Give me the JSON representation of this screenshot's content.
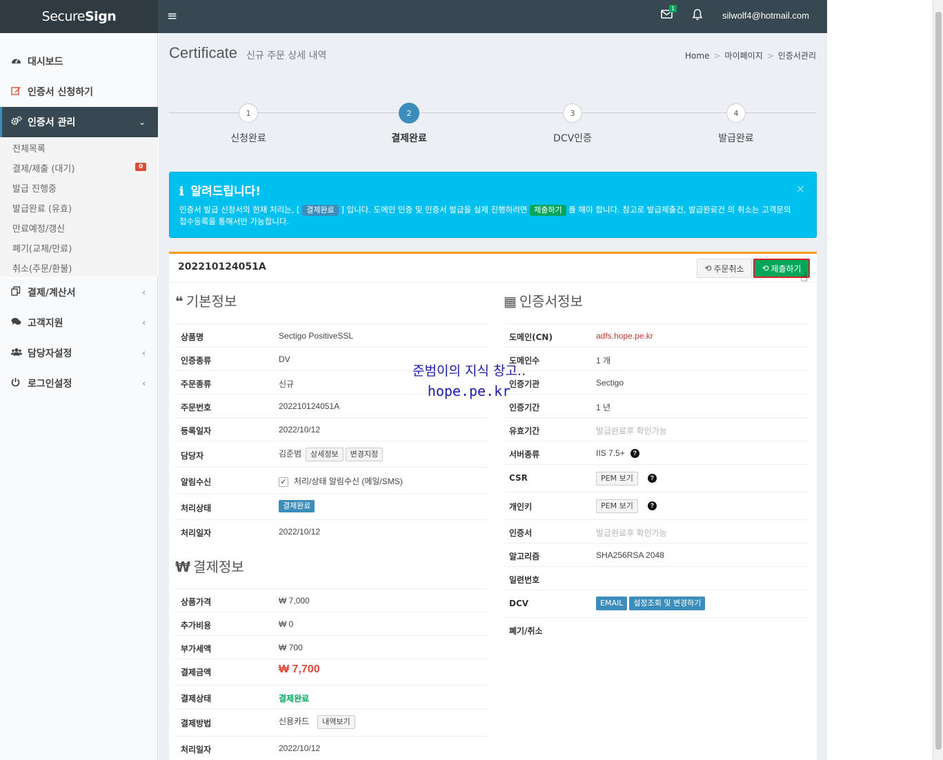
{
  "brand": {
    "logo_light": "Secure",
    "logo_bold": "Sign"
  },
  "topbar": {
    "menu_icon": "≡",
    "mail_count": "1",
    "user_email": "silwolf4@hotmail.com"
  },
  "sidebar": {
    "items": [
      {
        "label": "대시보드",
        "icon": "dashboard-icon"
      },
      {
        "label": "인증서 신청하기",
        "icon": "edit-icon"
      },
      {
        "label": "인증서 관리",
        "icon": "gears-icon"
      },
      {
        "label": "결제/계산서",
        "icon": "copy-icon"
      },
      {
        "label": "고객지원",
        "icon": "comments-icon"
      },
      {
        "label": "담당자설정",
        "icon": "users-icon"
      },
      {
        "label": "로그인설정",
        "icon": "power-icon"
      }
    ],
    "submenu": [
      "전체목록",
      "결제/제출 (대기)",
      "발급 진행중",
      "발급완료 (유효)",
      "만료예정/갱신",
      "폐기(교체/만료)",
      "취소(주문/환불)"
    ],
    "badge": "0"
  },
  "page": {
    "title": "Certificate",
    "subtitle": "신규 주문 상세 내역"
  },
  "breadcrumb": [
    "Home",
    "마이페이지",
    "인증서관리"
  ],
  "steps": [
    {
      "num": "1",
      "label": "신청완료"
    },
    {
      "num": "2",
      "label": "결제완료"
    },
    {
      "num": "3",
      "label": "DCV인증"
    },
    {
      "num": "4",
      "label": "발급완료"
    }
  ],
  "alert": {
    "title": "알려드립니다!",
    "text1": "인증서 발급 신청서의 현재 처리는, [",
    "pill1": "결제완료",
    "text2": "] 입니다. 도메인 인증 및 인증서 발급을 실제 진행하려면",
    "pill2": "제출하기",
    "text3": "를 해야 합니다. 참고로 발급제출건, 발급완료건 의 취소는 고객문의 접수등록을 통해서만 가능합니다.",
    "close": "×"
  },
  "order": {
    "number": "202210124051A",
    "cancel_label": "주문취소",
    "submit_label": "제출하기"
  },
  "basic": {
    "title": "기본정보",
    "rows": [
      {
        "label": "상품명",
        "value": "Sectigo PositiveSSL"
      },
      {
        "label": "인증종류",
        "value": "DV"
      },
      {
        "label": "주문종류",
        "value": "신규"
      },
      {
        "label": "주문번호",
        "value": "202210124051A"
      },
      {
        "label": "등록일자",
        "value": "2022/10/12"
      },
      {
        "label": "담당자",
        "value": "김준범",
        "btn1": "상세정보",
        "btn2": "변경지정"
      },
      {
        "label": "알림수신",
        "value": "처리/상태 알림수신 (메일/SMS)"
      },
      {
        "label": "처리상태",
        "value": "결제완료"
      },
      {
        "label": "처리일자",
        "value": "2022/10/12"
      }
    ]
  },
  "payment": {
    "title": "결제정보",
    "rows": [
      {
        "label": "상품가격",
        "value": "₩ 7,000"
      },
      {
        "label": "추가비용",
        "value": "₩ 0"
      },
      {
        "label": "부가세액",
        "value": "₩ 700"
      },
      {
        "label": "결제금액",
        "value": "₩ 7,700"
      },
      {
        "label": "결제상태",
        "value": "결제완료"
      },
      {
        "label": "결제방법",
        "value": "신용카드",
        "btn": "내역보기"
      },
      {
        "label": "처리일자",
        "value": "2022/10/12"
      }
    ]
  },
  "cert": {
    "title": "인증서정보",
    "rows": [
      {
        "label": "도메인(CN)",
        "value": "adfs.hope.pe.kr"
      },
      {
        "label": "도메인수",
        "value": "1 개"
      },
      {
        "label": "인증기관",
        "value": "Sectigo"
      },
      {
        "label": "인증기간",
        "value": "1 년"
      },
      {
        "label": "유효기간",
        "value": "발급완료후 확인가능"
      },
      {
        "label": "서버종류",
        "value": "IIS 7.5+"
      },
      {
        "label": "CSR",
        "value": "PEM 보기"
      },
      {
        "label": "개인키",
        "value": "PEM 보기"
      },
      {
        "label": "인증서",
        "value": "발급완료후 확인가능"
      },
      {
        "label": "알고리즘",
        "value": "SHA256RSA 2048"
      },
      {
        "label": "일련번호",
        "value": ""
      },
      {
        "label": "DCV",
        "value": "EMAIL",
        "btn": "설정조회 및 변경하기"
      },
      {
        "label": "폐기/취소",
        "value": ""
      }
    ]
  },
  "watermark": {
    "line1": "준범이의 지식 창고..",
    "line2": "hope.pe.kr"
  }
}
